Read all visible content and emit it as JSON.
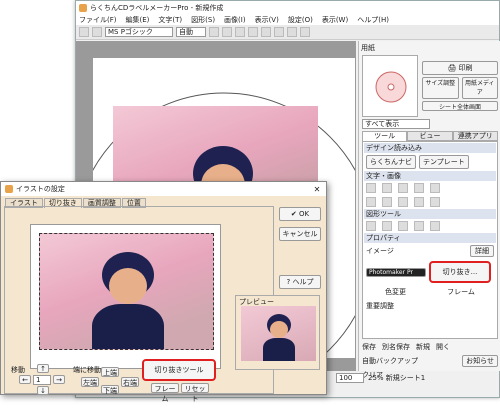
{
  "main_window": {
    "title": "らくちんCDラベルメーカーPro - 新規作成",
    "menu": [
      "ファイル(F)",
      "編集(E)",
      "文字(T)",
      "図形(S)",
      "画像(I)",
      "表示(V)",
      "設定(O)",
      "表示(W)",
      "ヘルプ(H)"
    ],
    "font_name": "MS Pゴシック",
    "font_size": "自動"
  },
  "right_panel": {
    "label_paper": "用紙",
    "print_button": "印刷",
    "size_adjust": "サイズ調整",
    "paper_media": "用紙メディア",
    "sheet_full": "シート全体画面",
    "display_all": "すべて表示",
    "tabs": [
      "ツール",
      "ビュー",
      "連携アプリ"
    ],
    "design_header": "デザイン読み込み",
    "rakuchin_navi": "らくちんナビ",
    "template": "テンプレート",
    "text_image": "文字・画像",
    "shape_tool": "図形ツール",
    "property": "プロパティ",
    "image_label": "イメージ",
    "detail": "詳細",
    "photomaker": "Photomaker Pr",
    "crop_button": "切り抜き...",
    "color_change": "色変更",
    "frame": "フレーム",
    "overlap_adjust": "重要調整",
    "save": "保存",
    "save_as": "別名保存",
    "new": "新規",
    "open": "開く",
    "auto_backup": "自動バックアップ",
    "notice": "お知らせ",
    "clear": "クリア",
    "zoom": "100",
    "status": "25% 新規シート1"
  },
  "dialog": {
    "title": "イラストの設定",
    "tabs": [
      "イラスト",
      "切り抜き",
      "画質調整",
      "位置"
    ],
    "ok": "OK",
    "cancel": "キャンセル",
    "help": "ヘルプ",
    "preview": "プレビュー",
    "move": "移動",
    "end_move": "端に移動",
    "up": "上端",
    "left": "左端",
    "right": "右端",
    "down": "下端",
    "crop_tool": "切り抜きツール",
    "frame": "フレーム",
    "reset": "リセット",
    "step_value": "1"
  },
  "colors": {
    "highlight": "#e02020",
    "dialog_bg": "#f4e6cf"
  }
}
